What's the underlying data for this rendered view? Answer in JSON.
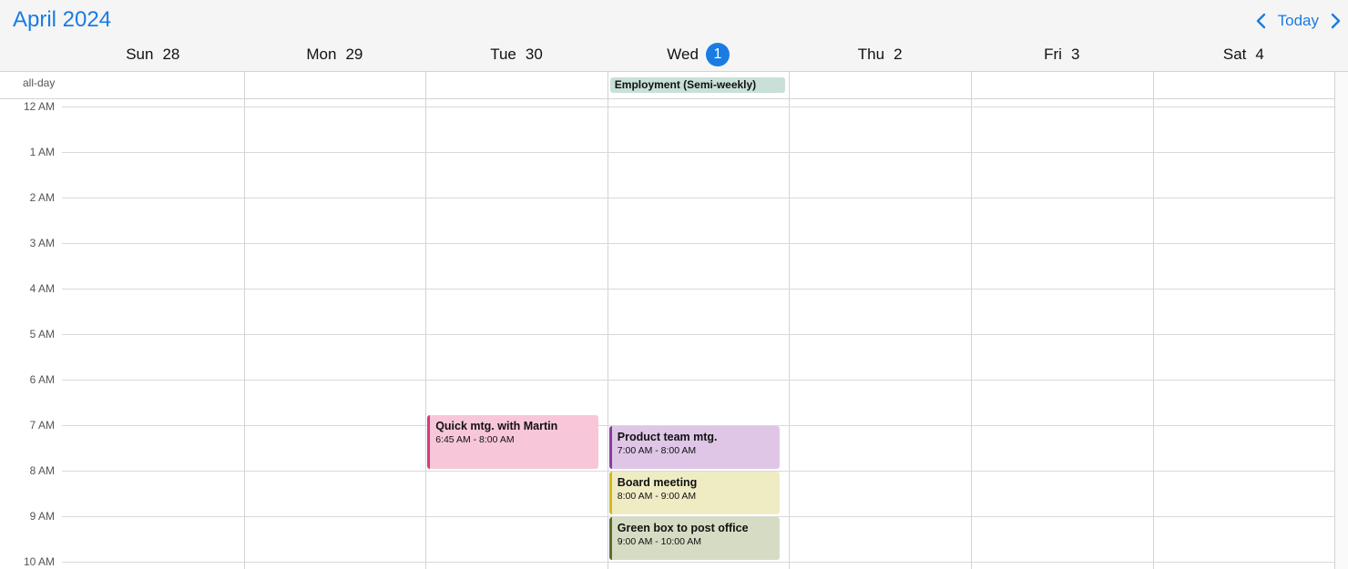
{
  "header": {
    "month_title": "April 2024",
    "today_label": "Today"
  },
  "days": [
    {
      "name": "Sun",
      "num": "28",
      "today": false
    },
    {
      "name": "Mon",
      "num": "29",
      "today": false
    },
    {
      "name": "Tue",
      "num": "30",
      "today": false
    },
    {
      "name": "Wed",
      "num": "1",
      "today": true
    },
    {
      "name": "Thu",
      "num": "2",
      "today": false
    },
    {
      "name": "Fri",
      "num": "3",
      "today": false
    },
    {
      "name": "Sat",
      "num": "4",
      "today": false
    }
  ],
  "allday": {
    "label": "all-day",
    "events": [
      {
        "title": "Employment (Semi-weekly)",
        "day": 3,
        "color": "#c9e0d9"
      }
    ]
  },
  "hours": [
    "12 AM",
    "1 AM",
    "2 AM",
    "3 AM",
    "4 AM",
    "5 AM",
    "6 AM",
    "7 AM",
    "8 AM",
    "9 AM",
    "10 AM"
  ],
  "events": [
    {
      "title": "Quick mtg. with Martin",
      "time": "6:45 AM - 8:00 AM",
      "day": 2,
      "start": 6.75,
      "end": 8.0,
      "bg": "#f8c6d9",
      "accent": "#d63a7c"
    },
    {
      "title": "Product team mtg.",
      "time": "7:00 AM - 8:00 AM",
      "day": 3,
      "start": 7.0,
      "end": 8.0,
      "bg": "#dfc6e6",
      "accent": "#8a3aa6"
    },
    {
      "title": "Board meeting",
      "time": "8:00 AM - 9:00 AM",
      "day": 3,
      "start": 8.0,
      "end": 9.0,
      "bg": "#efecc4",
      "accent": "#d2bb1e"
    },
    {
      "title": "Green box to post office",
      "time": "9:00 AM - 10:00 AM",
      "day": 3,
      "start": 9.0,
      "end": 10.0,
      "bg": "#d6dcc4",
      "accent": "#5c6d32"
    }
  ]
}
